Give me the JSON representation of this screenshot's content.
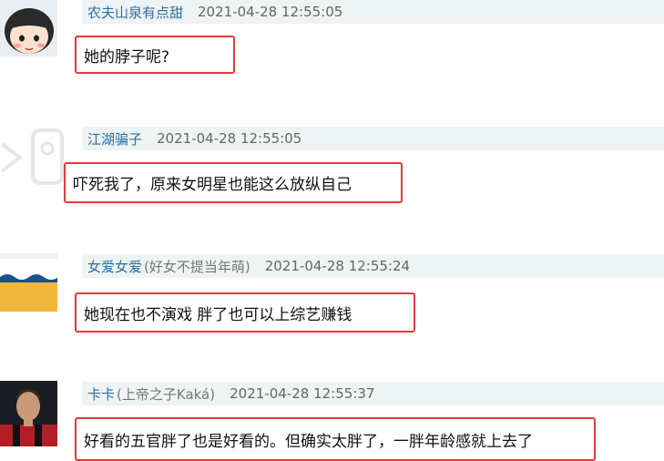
{
  "comments": [
    {
      "username": "农夫山泉有点甜",
      "alias": "",
      "time": "2021-04-28 12:55:05",
      "text": "她的脖子呢?",
      "avatar": "cartoon-girl-icon"
    },
    {
      "username": "江湖骗子",
      "alias": "",
      "time": "2021-04-28 12:55:05",
      "text": "吓死我了，原来女明星也能这么放纵自己",
      "avatar": "default-avatar-icon"
    },
    {
      "username": "女爱女爱",
      "alias": "(好女不提当年萌)",
      "time": "2021-04-28 12:55:24",
      "text": "她现在也不演戏 胖了也可以上综艺赚钱",
      "avatar": "beach-avatar-icon"
    },
    {
      "username": "卡卡",
      "alias": "(上帝之子Kaká)",
      "time": "2021-04-28 12:55:37",
      "text": "好看的五官胖了也是好看的。但确实太胖了，一胖年龄感就上去了",
      "avatar": "football-player-avatar-icon"
    }
  ],
  "colors": {
    "highlight_border": "#e23b3b",
    "username": "#2e6fa1",
    "header_bg": "#eef3f3"
  }
}
